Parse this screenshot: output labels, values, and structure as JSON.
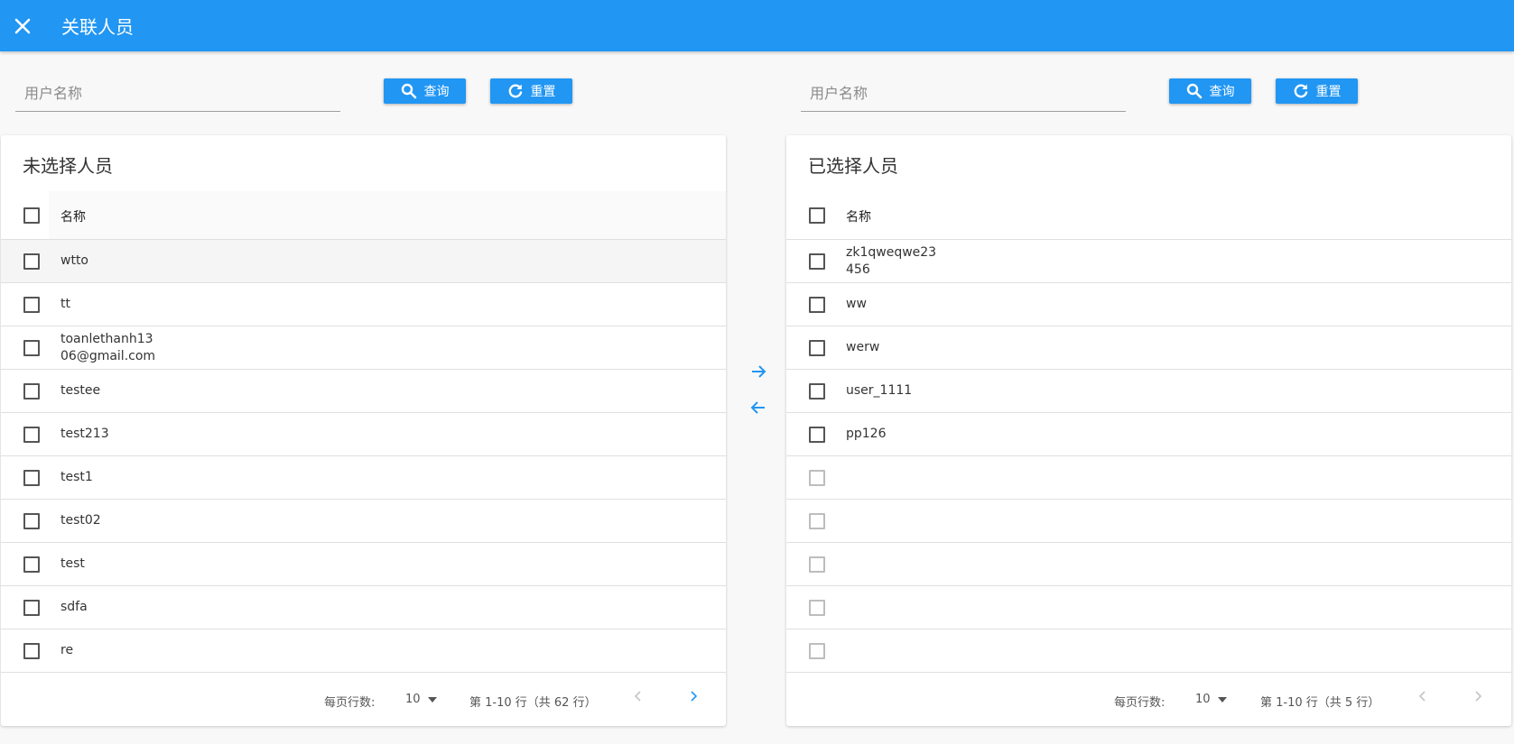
{
  "header": {
    "title": "关联人员",
    "close_icon": "close-icon"
  },
  "left": {
    "search": {
      "placeholder": "用户名称",
      "value": ""
    },
    "query_label": "查询",
    "reset_label": "重置",
    "panel_title": "未选择人员",
    "column_name": "名称",
    "rows": [
      "wtto",
      "tt",
      "toanlethanh13\n06@gmail.com",
      "testee",
      "test213",
      "test1",
      "test02",
      "test",
      "sdfa",
      "re"
    ],
    "pager": {
      "rows_per_page_label": "每页行数:",
      "rows_per_page": "10",
      "range": "第 1-10 行（共 62 行）"
    }
  },
  "right": {
    "search": {
      "placeholder": "用户名称",
      "value": ""
    },
    "query_label": "查询",
    "reset_label": "重置",
    "panel_title": "已选择人员",
    "column_name": "名称",
    "rows": [
      "zk1qweqwe23\n456",
      "ww",
      "werw",
      "user_1111",
      "pp126",
      "",
      "",
      "",
      "",
      ""
    ],
    "pager": {
      "rows_per_page_label": "每页行数:",
      "rows_per_page": "10",
      "range": "第 1-10 行（共 5 行）"
    }
  },
  "colors": {
    "primary": "#2196f3",
    "background": "#f8f8f8",
    "row_hover": "#f5f5f5"
  }
}
